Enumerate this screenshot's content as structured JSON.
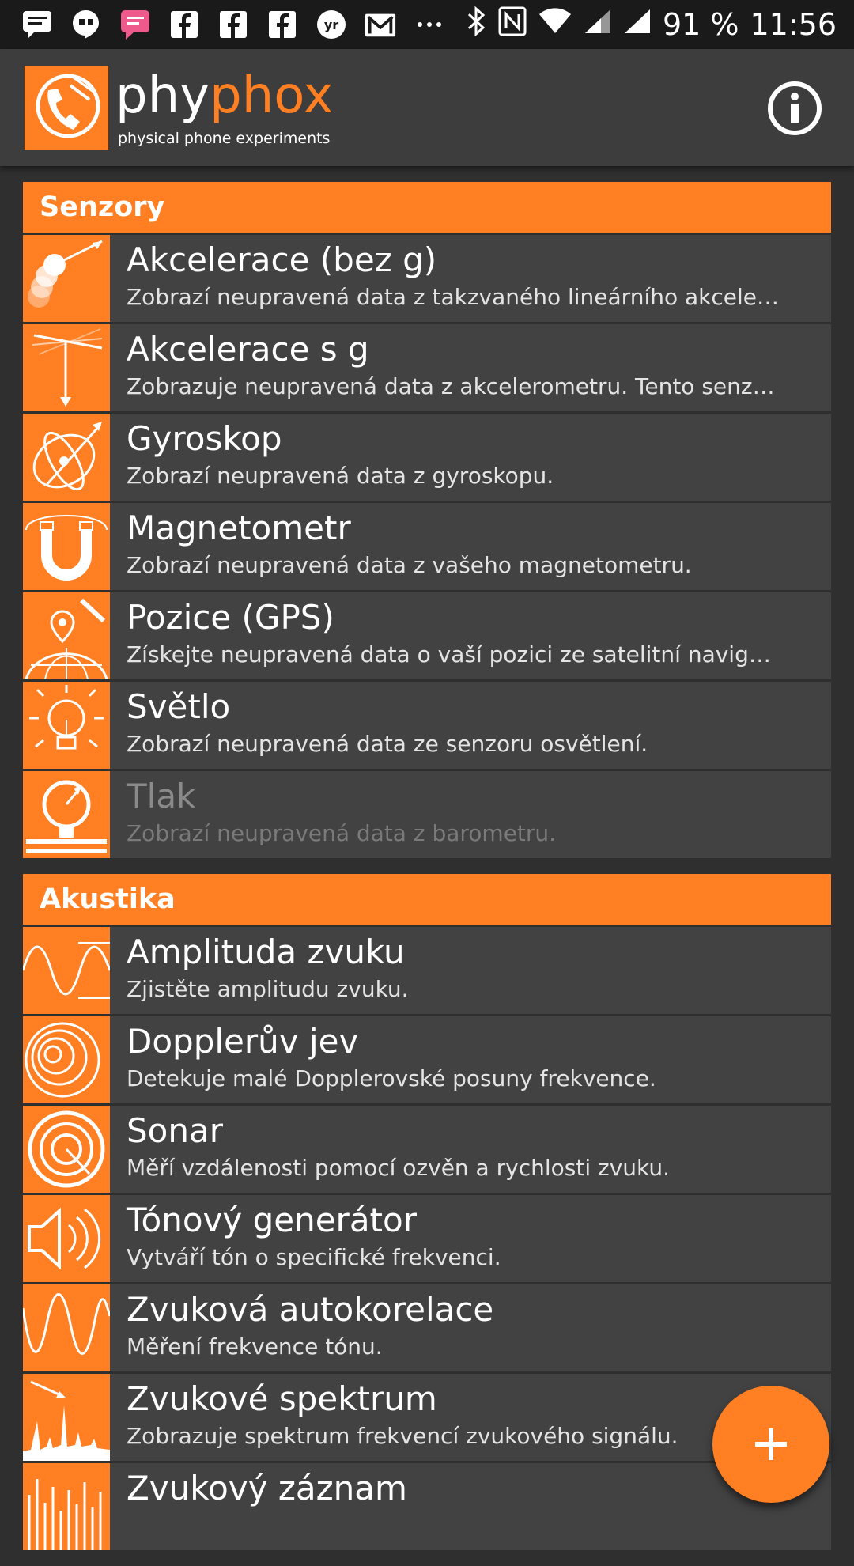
{
  "status_bar": {
    "notification_icons": [
      "message-icon",
      "hangouts-icon",
      "chat-icon",
      "facebook-icon",
      "facebook-icon",
      "facebook-icon",
      "yr-icon",
      "gmail-icon",
      "more-icon"
    ],
    "battery_percent": "91 %",
    "time": "11:56"
  },
  "app": {
    "logo_word_part1": "phy",
    "logo_word_part2": "phox",
    "subtitle": "physical phone experiments",
    "accent_color": "#ff7f22"
  },
  "categories": [
    {
      "name": "Senzory",
      "items": [
        {
          "title": "Akcelerace (bez g)",
          "desc": "Zobrazí neupravená data z takzvaného lineárního akcele…"
        },
        {
          "title": "Akcelerace s g",
          "desc": "Zobrazuje neupravená data z akcelerometru. Tento senz…"
        },
        {
          "title": "Gyroskop",
          "desc": "Zobrazí neupravená data z gyroskopu."
        },
        {
          "title": "Magnetometr",
          "desc": "Zobrazí neupravená data z vašeho magnetometru."
        },
        {
          "title": "Pozice (GPS)",
          "desc": "Získejte neupravená data o vaší pozici ze satelitní navig…"
        },
        {
          "title": "Světlo",
          "desc": "Zobrazí neupravená data ze senzoru osvětlení."
        },
        {
          "title": "Tlak",
          "desc": "Zobrazí neupravená data z barometru."
        }
      ]
    },
    {
      "name": "Akustika",
      "items": [
        {
          "title": "Amplituda zvuku",
          "desc": "Zjistěte amplitudu zvuku."
        },
        {
          "title": "Dopplerův jev",
          "desc": "Detekuje malé Dopplerovské posuny frekvence."
        },
        {
          "title": "Sonar",
          "desc": "Měří vzdálenosti pomocí ozvěn a rychlosti zvuku."
        },
        {
          "title": "Tónový generátor",
          "desc": "Vytváří tón o specifické frekvenci."
        },
        {
          "title": "Zvuková autokorelace",
          "desc": "Měření frekvence tónu."
        },
        {
          "title": "Zvukové spektrum",
          "desc": "Zobrazuje spektrum frekvencí zvukového signálu."
        },
        {
          "title": "Zvukový záznam",
          "desc": ""
        }
      ]
    }
  ],
  "fab_symbol": "+"
}
